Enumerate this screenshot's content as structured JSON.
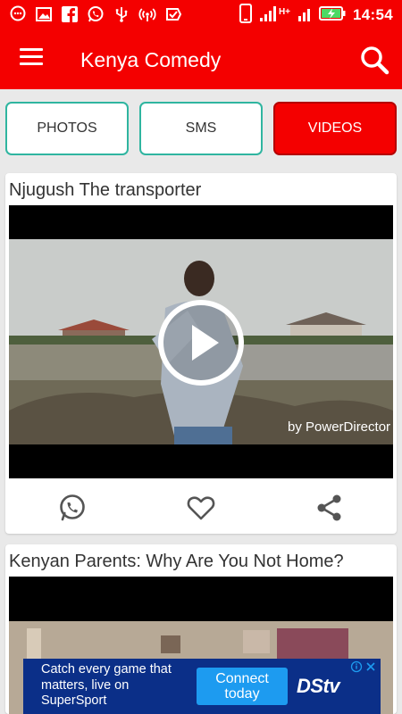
{
  "status_bar": {
    "time": "14:54",
    "network_type": "H+"
  },
  "app_bar": {
    "title": "Kenya Comedy"
  },
  "tabs": [
    {
      "label": "PHOTOS",
      "active": false
    },
    {
      "label": "SMS",
      "active": false
    },
    {
      "label": "VIDEOS",
      "active": true
    }
  ],
  "videos": [
    {
      "title": "Njugush The transporter",
      "watermark": "by PowerDirector",
      "actions": [
        "whatsapp-share",
        "favorite",
        "share"
      ]
    },
    {
      "title": "Kenyan Parents: Why Are You Not Home?"
    }
  ],
  "ad": {
    "text": "Catch every game that matters, live on SuperSport",
    "cta": "Connect today",
    "brand": "DStv"
  },
  "colors": {
    "primary": "#f40000",
    "tab_border": "#2fb5a0",
    "ad_background": "#0b2f88",
    "ad_cta": "#1d9bf0"
  }
}
